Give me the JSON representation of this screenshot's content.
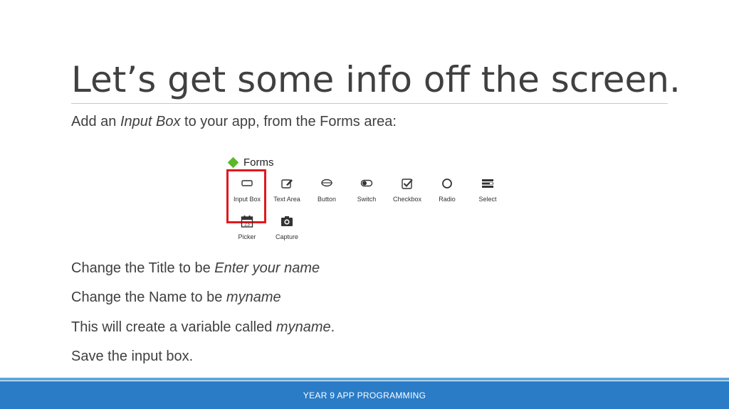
{
  "slide": {
    "title": "Let’s get some info off the screen.",
    "intro": {
      "prefix": "Add an ",
      "emphasis": "Input Box",
      "suffix": " to your app, from the Forms area:"
    },
    "steps": [
      {
        "prefix": "Change the Title to be ",
        "emphasis": "Enter your name",
        "suffix": ""
      },
      {
        "prefix": "Change the Name to be ",
        "emphasis": "myname",
        "suffix": ""
      },
      {
        "prefix": "This will create a variable called ",
        "emphasis": "myname",
        "suffix": "."
      },
      {
        "prefix": "Save the input box.",
        "emphasis": "",
        "suffix": ""
      }
    ],
    "footer": "YEAR 9 APP PROGRAMMING"
  },
  "forms_panel": {
    "heading": "Forms",
    "widgets": [
      {
        "label": "Input Box",
        "icon": "input-box-icon"
      },
      {
        "label": "Text Area",
        "icon": "text-area-icon"
      },
      {
        "label": "Button",
        "icon": "button-icon"
      },
      {
        "label": "Switch",
        "icon": "switch-icon"
      },
      {
        "label": "Checkbox",
        "icon": "checkbox-icon"
      },
      {
        "label": "Radio",
        "icon": "radio-icon"
      },
      {
        "label": "Select",
        "icon": "select-icon"
      },
      {
        "label": "Picker",
        "icon": "calendar-icon",
        "icon_text": "23"
      },
      {
        "label": "Capture",
        "icon": "camera-icon"
      }
    ],
    "highlighted": "Input Box",
    "colors": {
      "highlight": "#e0191e",
      "diamond": "#5cb82a",
      "footer": "#2a7cc7"
    }
  }
}
